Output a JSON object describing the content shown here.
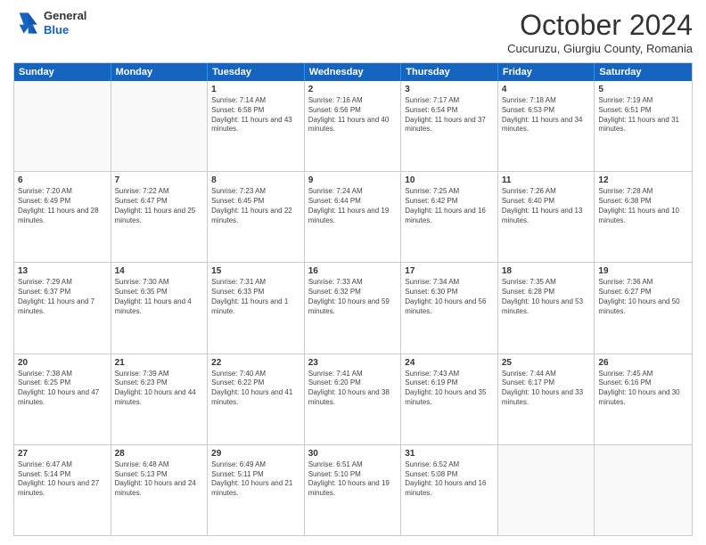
{
  "logo": {
    "general": "General",
    "blue": "Blue"
  },
  "header": {
    "month": "October 2024",
    "location": "Cucuruzu, Giurgiu County, Romania"
  },
  "days": [
    "Sunday",
    "Monday",
    "Tuesday",
    "Wednesday",
    "Thursday",
    "Friday",
    "Saturday"
  ],
  "rows": [
    [
      {
        "day": "",
        "info": ""
      },
      {
        "day": "",
        "info": ""
      },
      {
        "day": "1",
        "info": "Sunrise: 7:14 AM\nSunset: 6:58 PM\nDaylight: 11 hours and 43 minutes."
      },
      {
        "day": "2",
        "info": "Sunrise: 7:16 AM\nSunset: 6:56 PM\nDaylight: 11 hours and 40 minutes."
      },
      {
        "day": "3",
        "info": "Sunrise: 7:17 AM\nSunset: 6:54 PM\nDaylight: 11 hours and 37 minutes."
      },
      {
        "day": "4",
        "info": "Sunrise: 7:18 AM\nSunset: 6:53 PM\nDaylight: 11 hours and 34 minutes."
      },
      {
        "day": "5",
        "info": "Sunrise: 7:19 AM\nSunset: 6:51 PM\nDaylight: 11 hours and 31 minutes."
      }
    ],
    [
      {
        "day": "6",
        "info": "Sunrise: 7:20 AM\nSunset: 6:49 PM\nDaylight: 11 hours and 28 minutes."
      },
      {
        "day": "7",
        "info": "Sunrise: 7:22 AM\nSunset: 6:47 PM\nDaylight: 11 hours and 25 minutes."
      },
      {
        "day": "8",
        "info": "Sunrise: 7:23 AM\nSunset: 6:45 PM\nDaylight: 11 hours and 22 minutes."
      },
      {
        "day": "9",
        "info": "Sunrise: 7:24 AM\nSunset: 6:44 PM\nDaylight: 11 hours and 19 minutes."
      },
      {
        "day": "10",
        "info": "Sunrise: 7:25 AM\nSunset: 6:42 PM\nDaylight: 11 hours and 16 minutes."
      },
      {
        "day": "11",
        "info": "Sunrise: 7:26 AM\nSunset: 6:40 PM\nDaylight: 11 hours and 13 minutes."
      },
      {
        "day": "12",
        "info": "Sunrise: 7:28 AM\nSunset: 6:38 PM\nDaylight: 11 hours and 10 minutes."
      }
    ],
    [
      {
        "day": "13",
        "info": "Sunrise: 7:29 AM\nSunset: 6:37 PM\nDaylight: 11 hours and 7 minutes."
      },
      {
        "day": "14",
        "info": "Sunrise: 7:30 AM\nSunset: 6:35 PM\nDaylight: 11 hours and 4 minutes."
      },
      {
        "day": "15",
        "info": "Sunrise: 7:31 AM\nSunset: 6:33 PM\nDaylight: 11 hours and 1 minute."
      },
      {
        "day": "16",
        "info": "Sunrise: 7:33 AM\nSunset: 6:32 PM\nDaylight: 10 hours and 59 minutes."
      },
      {
        "day": "17",
        "info": "Sunrise: 7:34 AM\nSunset: 6:30 PM\nDaylight: 10 hours and 56 minutes."
      },
      {
        "day": "18",
        "info": "Sunrise: 7:35 AM\nSunset: 6:28 PM\nDaylight: 10 hours and 53 minutes."
      },
      {
        "day": "19",
        "info": "Sunrise: 7:36 AM\nSunset: 6:27 PM\nDaylight: 10 hours and 50 minutes."
      }
    ],
    [
      {
        "day": "20",
        "info": "Sunrise: 7:38 AM\nSunset: 6:25 PM\nDaylight: 10 hours and 47 minutes."
      },
      {
        "day": "21",
        "info": "Sunrise: 7:39 AM\nSunset: 6:23 PM\nDaylight: 10 hours and 44 minutes."
      },
      {
        "day": "22",
        "info": "Sunrise: 7:40 AM\nSunset: 6:22 PM\nDaylight: 10 hours and 41 minutes."
      },
      {
        "day": "23",
        "info": "Sunrise: 7:41 AM\nSunset: 6:20 PM\nDaylight: 10 hours and 38 minutes."
      },
      {
        "day": "24",
        "info": "Sunrise: 7:43 AM\nSunset: 6:19 PM\nDaylight: 10 hours and 35 minutes."
      },
      {
        "day": "25",
        "info": "Sunrise: 7:44 AM\nSunset: 6:17 PM\nDaylight: 10 hours and 33 minutes."
      },
      {
        "day": "26",
        "info": "Sunrise: 7:45 AM\nSunset: 6:16 PM\nDaylight: 10 hours and 30 minutes."
      }
    ],
    [
      {
        "day": "27",
        "info": "Sunrise: 6:47 AM\nSunset: 5:14 PM\nDaylight: 10 hours and 27 minutes."
      },
      {
        "day": "28",
        "info": "Sunrise: 6:48 AM\nSunset: 5:13 PM\nDaylight: 10 hours and 24 minutes."
      },
      {
        "day": "29",
        "info": "Sunrise: 6:49 AM\nSunset: 5:11 PM\nDaylight: 10 hours and 21 minutes."
      },
      {
        "day": "30",
        "info": "Sunrise: 6:51 AM\nSunset: 5:10 PM\nDaylight: 10 hours and 19 minutes."
      },
      {
        "day": "31",
        "info": "Sunrise: 6:52 AM\nSunset: 5:08 PM\nDaylight: 10 hours and 16 minutes."
      },
      {
        "day": "",
        "info": ""
      },
      {
        "day": "",
        "info": ""
      }
    ]
  ]
}
